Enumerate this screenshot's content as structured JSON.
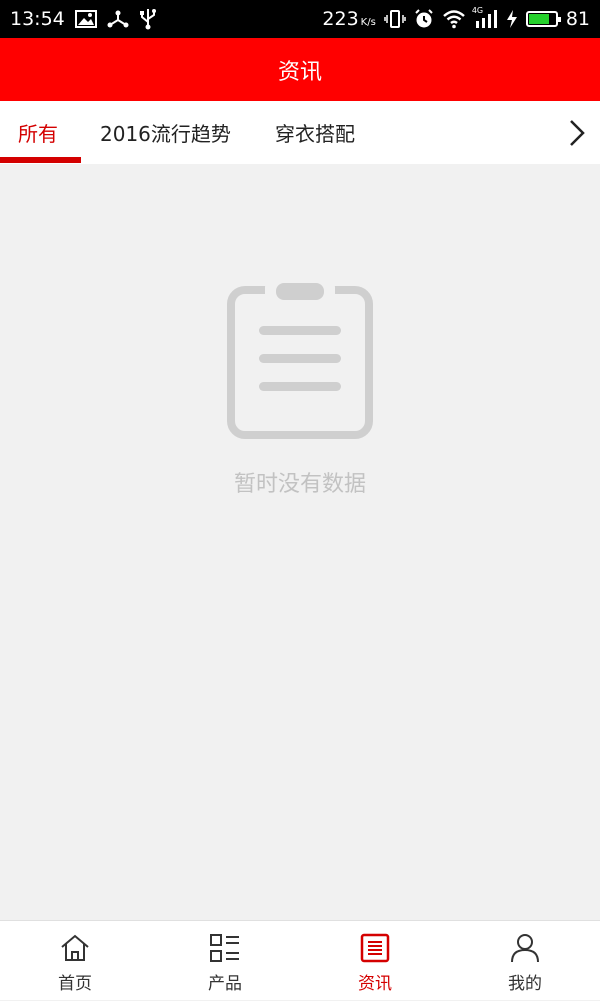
{
  "status_bar": {
    "time": "13:54",
    "net_speed": "223",
    "net_speed_unit": "K/s",
    "network_type": "4G",
    "battery_level": "81",
    "icons": [
      "image-icon",
      "share-icon",
      "usb-icon",
      "vibrate-icon",
      "alarm-icon",
      "wifi-icon",
      "signal-icon",
      "charging-icon",
      "battery-icon"
    ]
  },
  "header": {
    "title": "资讯"
  },
  "tabs": [
    {
      "label": "所有",
      "active": true
    },
    {
      "label": "2016流行趋势",
      "active": false
    },
    {
      "label": "穿衣搭配",
      "active": false
    }
  ],
  "empty_state": {
    "icon": "clipboard-icon",
    "message": "暂时没有数据"
  },
  "bottom_nav": [
    {
      "label": "首页",
      "icon": "home-icon",
      "active": false
    },
    {
      "label": "产品",
      "icon": "product-list-icon",
      "active": false
    },
    {
      "label": "资讯",
      "icon": "news-icon",
      "active": true
    },
    {
      "label": "我的",
      "icon": "user-icon",
      "active": false
    }
  ],
  "colors": {
    "brand": "#ff0000",
    "accent": "#d40000",
    "background": "#f1f1f1",
    "battery": "#26d12c"
  }
}
